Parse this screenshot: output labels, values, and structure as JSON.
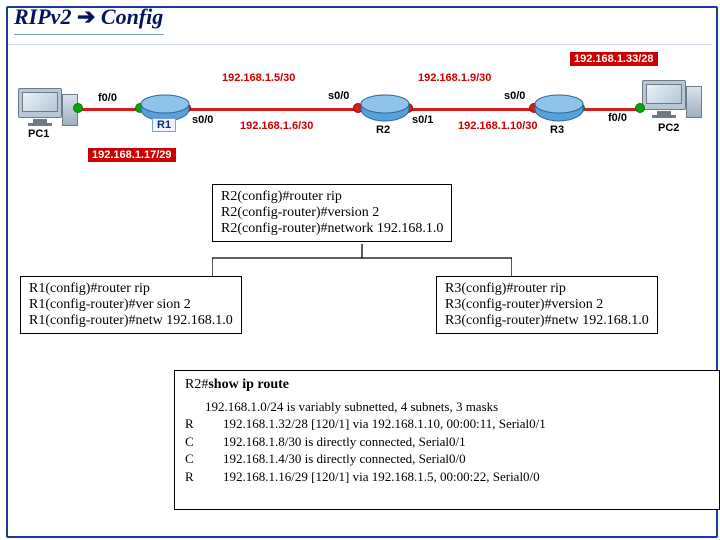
{
  "title_part1": "RIPv2 ",
  "title_arrow": "➔",
  "title_part2": " Config",
  "topo": {
    "pc1": "PC1",
    "pc2": "PC2",
    "r1": "R1",
    "r2": "R2",
    "r3": "R3",
    "badge_topright": "192.168.1.33/28",
    "badge_r1lan": "192.168.1.17/29",
    "if_pc1": "f0/0",
    "if_pc2": "f0/0",
    "if_r1_s00": "s0/0",
    "if_r2_s00": "s0/0",
    "if_r2_s01": "s0/1",
    "if_r3_s00": "s0/0",
    "net_r1r2_top": "192.168.1.5/30",
    "net_r1r2_bot": "192.168.1.6/30",
    "net_r2r3_top": "192.168.1.9/30",
    "net_r2r3_bot": "192.168.1.10/30"
  },
  "cfg": {
    "r2": [
      "R2(config)#router rip",
      "R2(config-router)#version 2",
      "R2(config-router)#network 192.168.1.0"
    ],
    "r1": [
      "R1(config)#router rip",
      "R1(config-router)#ver sion 2",
      "R1(config-router)#netw 192.168.1.0"
    ],
    "r3": [
      "R3(config)#router rip",
      "R3(config-router)#version 2",
      "R3(config-router)#netw 192.168.1.0"
    ]
  },
  "route": {
    "header_prefix": "R2#",
    "header_cmd": "show ip route",
    "summary": "192.168.1.0/24 is variably subnetted, 4 subnets, 3 masks",
    "rows": [
      {
        "code": "R",
        "text": "192.168.1.32/28 [120/1] via 192.168.1.10, 00:00:11, Serial0/1"
      },
      {
        "code": "C",
        "text": "192.168.1.8/30 is directly connected, Serial0/1"
      },
      {
        "code": "C",
        "text": "192.168.1.4/30 is directly connected, Serial0/0"
      },
      {
        "code": "R",
        "text": "192.168.1.16/29 [120/1] via 192.168.1.5, 00:00:22, Serial0/0"
      }
    ]
  }
}
